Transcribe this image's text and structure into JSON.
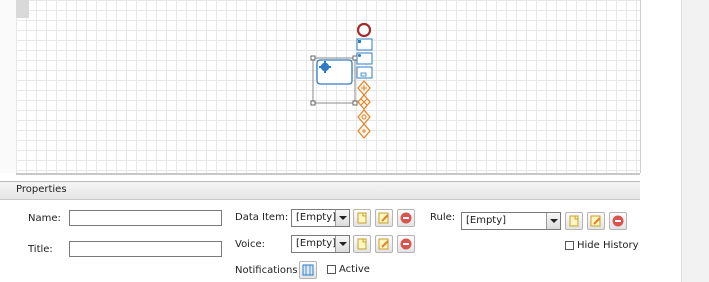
{
  "canvas": {
    "shapes": [
      {
        "kind": "end-event",
        "icon": "red-circle-icon"
      },
      {
        "kind": "task-mini",
        "icon": "blue-task-icon"
      },
      {
        "kind": "task-mini",
        "icon": "blue-task-icon"
      },
      {
        "kind": "task-mini",
        "icon": "blue-task-icon"
      },
      {
        "kind": "gateway",
        "icon": "orange-gateway-icon"
      },
      {
        "kind": "gateway",
        "icon": "orange-gateway-icon"
      },
      {
        "kind": "gateway",
        "icon": "orange-gateway-icon"
      },
      {
        "kind": "gateway",
        "icon": "orange-gateway-icon"
      }
    ],
    "selected_node_icon": "gear-icon"
  },
  "properties": {
    "title": "Properties",
    "name_label": "Name:",
    "name_value": "",
    "title_label": "Title:",
    "title_value": "",
    "data_item_label": "Data Item:",
    "data_item_value": "[Empty]",
    "voice_label": "Voice:",
    "voice_value": "[Empty]",
    "rule_label": "Rule:",
    "rule_value": "[Empty]",
    "notifications_label": "Notifications :",
    "active_label": "Active",
    "hide_history_label": "Hide History"
  },
  "colors": {
    "accent_blue": "#2e7cc6",
    "gateway_orange": "#e0832a",
    "end_event_red": "#b22222",
    "delete_red": "#d9534f"
  }
}
